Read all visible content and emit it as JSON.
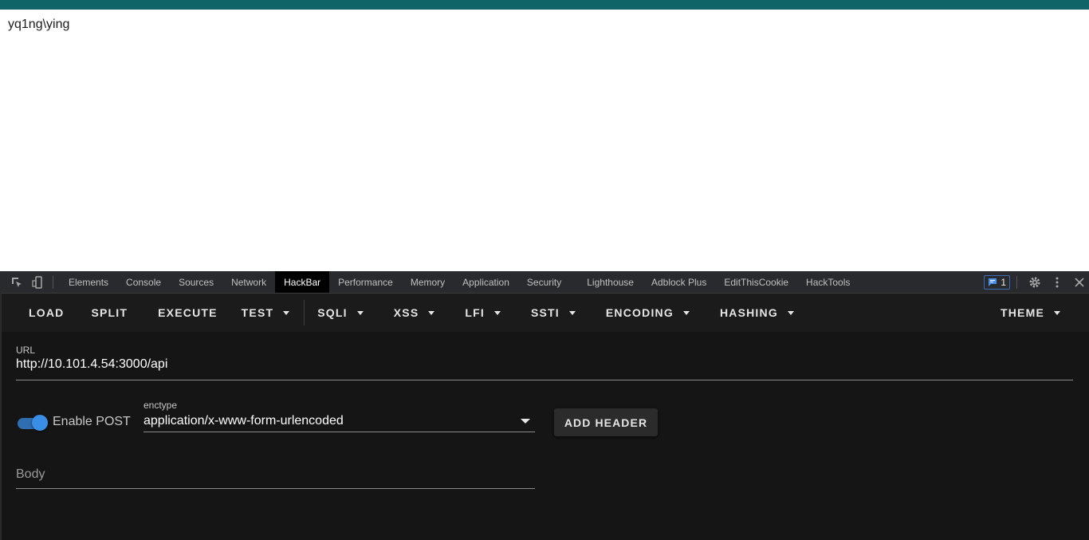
{
  "page": {
    "text": "yq1ng\\ying"
  },
  "devtools": {
    "tabs": [
      {
        "label": "Elements"
      },
      {
        "label": "Console"
      },
      {
        "label": "Sources"
      },
      {
        "label": "Network"
      },
      {
        "label": "HackBar",
        "active": true
      },
      {
        "label": "Performance"
      },
      {
        "label": "Memory"
      },
      {
        "label": "Application"
      },
      {
        "label": "Security"
      },
      {
        "label": "Lighthouse"
      },
      {
        "label": "Adblock Plus"
      },
      {
        "label": "EditThisCookie"
      },
      {
        "label": "HackTools"
      }
    ],
    "message_count": "1",
    "icons": [
      "inspect-element-icon",
      "device-toolbar-icon",
      "message-icon",
      "gear-icon",
      "more-vertical-icon",
      "close-icon"
    ]
  },
  "hackbar": {
    "toolbar": {
      "load": "LOAD",
      "split": "SPLIT",
      "execute": "EXECUTE",
      "test": "TEST",
      "sqli": "SQLI",
      "xss": "XSS",
      "lfi": "LFI",
      "ssti": "SSTI",
      "encoding": "ENCODING",
      "hashing": "HASHING",
      "theme": "THEME"
    },
    "url_label": "URL",
    "url_value": "http://10.101.4.54:3000/api",
    "enable_post_label": "Enable POST",
    "enable_post": true,
    "enctype_label": "enctype",
    "enctype_value": "application/x-www-form-urlencoded",
    "add_header": "ADD HEADER",
    "body_placeholder": "Body"
  },
  "colors": {
    "top_strip": "#0f6468",
    "toggle_accent": "#3a8ee6",
    "badge_border": "#3d6bb3"
  }
}
